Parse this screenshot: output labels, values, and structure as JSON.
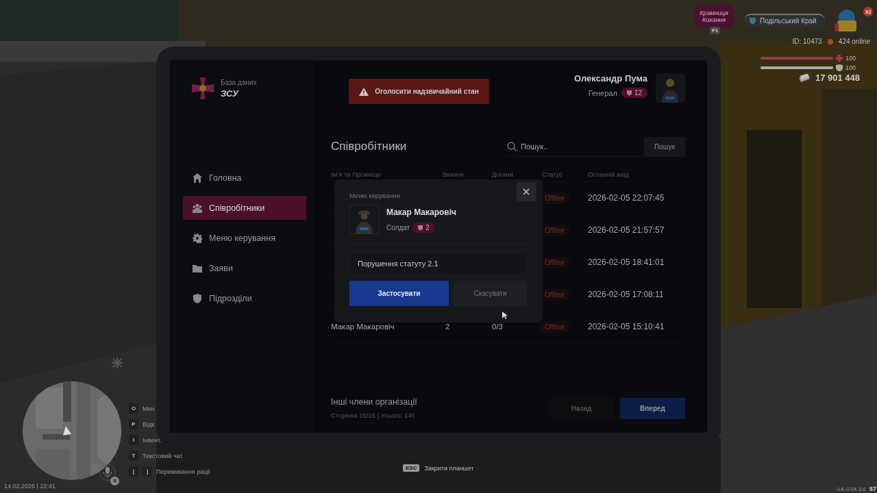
{
  "hud": {
    "shop_logo": "Крамниця Кохання",
    "shop_key": "F1",
    "server": "Подільський Край",
    "event_badge": "X2",
    "player_id": "ID: 10473",
    "online": "424 online",
    "stats": [
      {
        "kind": "health",
        "level": 1,
        "reading": "100"
      },
      {
        "kind": "armor",
        "level": 1,
        "reading": "100"
      }
    ],
    "money": "17 901 448",
    "hints": [
      {
        "keys": [
          "O"
        ],
        "label": "Мен"
      },
      {
        "keys": [
          "P"
        ],
        "label": "Відк"
      },
      {
        "keys": [
          "I"
        ],
        "label": "Інвент."
      },
      {
        "keys": [
          "T"
        ],
        "label": "Текстовий чат"
      },
      {
        "keys": [
          "[",
          "]"
        ],
        "label": "Перемикання рації"
      }
    ],
    "voice_key": "Я",
    "datetime": "14.02.2026 | 22:41",
    "close_hint": {
      "key": "ESC",
      "label": "Закрити планшет"
    },
    "version": "UA-GTA 3.6",
    "fps": "57"
  },
  "tablet": {
    "brand": {
      "subtitle": "База даних",
      "title": "ЗСУ"
    },
    "alert_button": "Оголосити надзвичайний стан",
    "user": {
      "name": "Олександр Пума",
      "rank": "Генерал",
      "rank_level": "12"
    },
    "sidebar": {
      "items": [
        {
          "label": "Головна",
          "selected": false
        },
        {
          "label": "Співробітники",
          "selected": true
        },
        {
          "label": "Меню керування",
          "selected": false
        },
        {
          "label": "Заяви",
          "selected": false
        },
        {
          "label": "Підрозділи",
          "selected": false
        }
      ]
    },
    "page_title": "Співробітники",
    "search": {
      "placeholder": "Пошук..",
      "button": "Пошук"
    },
    "table": {
      "columns": [
        "Імʼя та Прізвище",
        "Звання",
        "Догани",
        "Статус",
        "Останній вхід"
      ],
      "rows": [
        {
          "status": "Offline",
          "last_login": "2026-02-05 22:07:45"
        },
        {
          "status": "Offline",
          "last_login": "2026-02-05 21:57:57"
        },
        {
          "status": "Offline",
          "last_login": "2026-02-05 18:41:01"
        },
        {
          "status": "Offline",
          "last_login": "2026-02-05 17:08:11"
        },
        {
          "name": "Макар Макаровіч",
          "rank": "2",
          "warnings": "0/3",
          "status": "Offline",
          "last_login": "2026-02-05 15:10:41"
        }
      ]
    },
    "footer": {
      "title": "Інші члени організації",
      "summary": "Сторінка 15/15 | Усього: 145"
    },
    "pagination": {
      "prev": "Назад",
      "next": "Вперед"
    }
  },
  "modal": {
    "title": "Меню керування",
    "name": "Макар Макаровіч",
    "rank": "Солдат",
    "rank_level": "2",
    "reason": "Порушення статуту 2.1",
    "apply": "Застосувати",
    "cancel": "Скасувати"
  }
}
